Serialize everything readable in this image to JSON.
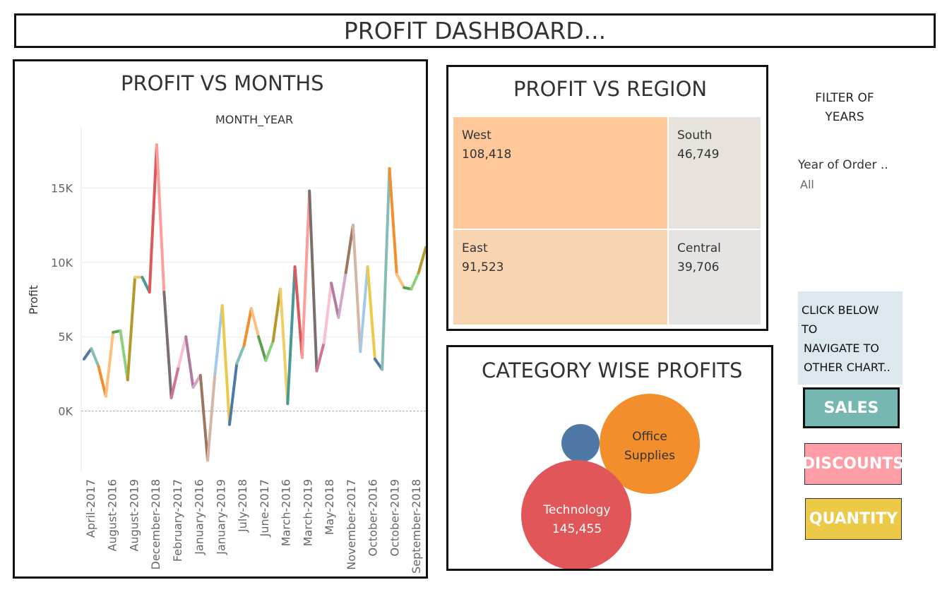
{
  "page": {
    "title": "PROFIT DASHBOARD..."
  },
  "months_chart": {
    "title": "PROFIT VS MONTHS",
    "subtitle": "MONTH_YEAR",
    "ylabel": "Profit",
    "yticks": [
      "15K",
      "10K",
      "5K",
      "0K"
    ],
    "xticks": [
      "April-2017",
      "August-2016",
      "August-2019",
      "December-2018",
      "February-2017",
      "January-2016",
      "January-2019",
      "July-2018",
      "June-2017",
      "March-2016",
      "March-2019",
      "May-2018",
      "November-2017",
      "October-2016",
      "October-2019",
      "September-2018"
    ]
  },
  "region_chart": {
    "title": "PROFIT VS REGION",
    "tiles": [
      {
        "name": "West",
        "value": "108,418",
        "color": "#ffc99c"
      },
      {
        "name": "South",
        "value": "46,749",
        "color": "#e8e2dd"
      },
      {
        "name": "East",
        "value": "91,523",
        "color": "#f9d4b1"
      },
      {
        "name": "Central",
        "value": "39,706",
        "color": "#e6e4e2"
      }
    ]
  },
  "category_chart": {
    "title": "CATEGORY WISE PROFITS",
    "office_label_1": "Office",
    "office_label_2": "Supplies",
    "tech_label": "Technology",
    "tech_value": "145,455"
  },
  "filter": {
    "title_line1": "FILTER OF",
    "title_line2": "YEARS",
    "label": "Year of Order ..",
    "value": "All"
  },
  "navigation": {
    "note_lines": [
      "CLICK BELOW",
      "TO",
      "NAVIGATE TO",
      "OTHER CHART.."
    ],
    "sales_label": "SALES",
    "discounts_label": "DISCOUNTS",
    "quantity_label": "QUANTITY"
  },
  "colors": {
    "sales": "#76b7b2",
    "discounts": "#ff9da7",
    "quantity": "#edc948",
    "furniture": "#4e79a7",
    "office_supplies": "#f28e2b",
    "technology": "#e15759"
  },
  "chart_data": [
    {
      "type": "line",
      "title": "PROFIT VS MONTHS",
      "subtitle": "MONTH_YEAR",
      "xlabel": "",
      "ylabel": "Profit",
      "ylim": [
        -4000,
        19000
      ],
      "grid": true,
      "x": [
        "1",
        "2",
        "3",
        "4",
        "5",
        "6",
        "7",
        "8",
        "9",
        "10",
        "11",
        "12",
        "13",
        "14",
        "15",
        "16",
        "17",
        "18",
        "19",
        "20",
        "21",
        "22",
        "23",
        "24",
        "25",
        "26",
        "27",
        "28",
        "29",
        "30",
        "31",
        "32",
        "33",
        "34",
        "35",
        "36",
        "37",
        "38",
        "39",
        "40",
        "41",
        "42",
        "43",
        "44",
        "45",
        "46",
        "47",
        "48"
      ],
      "xtick_labels": [
        "April-2017",
        "August-2016",
        "August-2019",
        "December-2018",
        "February-2017",
        "January-2016",
        "January-2019",
        "July-2018",
        "June-2017",
        "March-2016",
        "March-2019",
        "May-2018",
        "November-2017",
        "October-2016",
        "October-2019",
        "September-2018"
      ],
      "values": [
        3500,
        4200,
        3000,
        1000,
        5300,
        5400,
        2100,
        9000,
        9000,
        8000,
        17900,
        8000,
        900,
        3000,
        5000,
        1600,
        2400,
        -3300,
        2500,
        7100,
        -900,
        3200,
        4400,
        6900,
        5000,
        3400,
        4700,
        8200,
        500,
        9700,
        3600,
        14800,
        2700,
        4600,
        8600,
        6300,
        9300,
        12500,
        4000,
        9700,
        3500,
        2800,
        16300,
        9200,
        8300,
        8200,
        9300,
        11000
      ]
    },
    {
      "type": "heatmap",
      "title": "PROFIT VS REGION",
      "categories": [
        "West",
        "South",
        "East",
        "Central"
      ],
      "values": [
        108418,
        46749,
        91523,
        39706
      ]
    },
    {
      "type": "scatter",
      "title": "CATEGORY WISE PROFITS",
      "categories": [
        "Technology",
        "Office Supplies",
        ""
      ],
      "values": [
        145455,
        122491,
        18451
      ]
    }
  ]
}
